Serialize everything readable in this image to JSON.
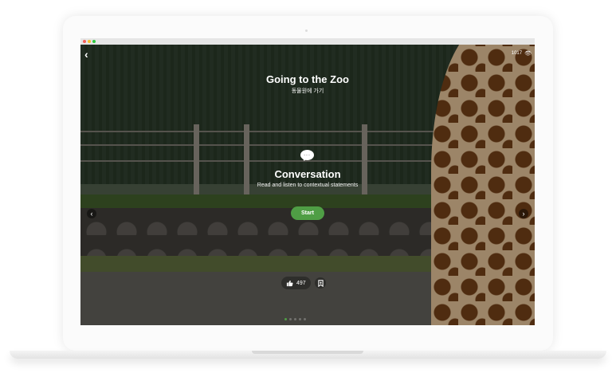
{
  "window": {
    "controls": [
      "close",
      "minimize",
      "maximize"
    ],
    "colors": {
      "close": "#f4605a",
      "minimize": "#f7c02c",
      "maximize": "#2fc940"
    }
  },
  "header": {
    "back_icon": "chevron-left-icon",
    "view_count": "1017",
    "view_icon": "eye-icon"
  },
  "lesson": {
    "title": "Going to the Zoo",
    "subtitle": "동물원에 가기"
  },
  "mode": {
    "icon": "speech-bubble-icon",
    "title": "Conversation",
    "description": "Read and listen to contextual statements",
    "start_label": "Start"
  },
  "navigation": {
    "prev_icon": "chevron-left-icon",
    "next_icon": "chevron-right-icon"
  },
  "actions": {
    "like_count": "497",
    "like_icon": "thumbs-up-icon",
    "bookmark_icon": "bookmark-icon"
  },
  "pager": {
    "count": 5,
    "active_index": 0
  },
  "colors": {
    "accent": "#4f9e45"
  }
}
